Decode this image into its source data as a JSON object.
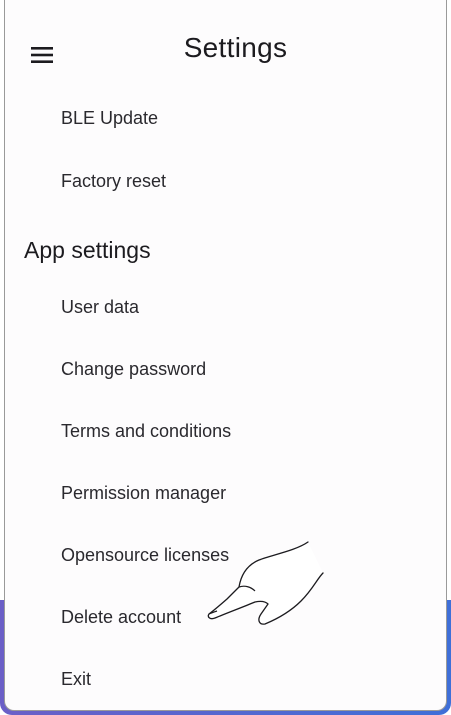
{
  "header": {
    "menu_icon": "hamburger-menu-icon",
    "title": "Settings"
  },
  "device_items": [
    {
      "label": "BLE Update"
    },
    {
      "label": "Factory reset"
    }
  ],
  "app_settings": {
    "title": "App settings",
    "items": [
      {
        "label": "User data"
      },
      {
        "label": "Change password"
      },
      {
        "label": "Terms and conditions"
      },
      {
        "label": "Permission manager"
      },
      {
        "label": "Opensource licenses"
      },
      {
        "label": "Delete account"
      },
      {
        "label": "Exit"
      }
    ]
  },
  "overlay": {
    "icon": "pointing-hand-icon"
  },
  "colors": {
    "background": "#fdfcfd",
    "text": "#1c1b1f",
    "accent": "#3f6fd8"
  }
}
